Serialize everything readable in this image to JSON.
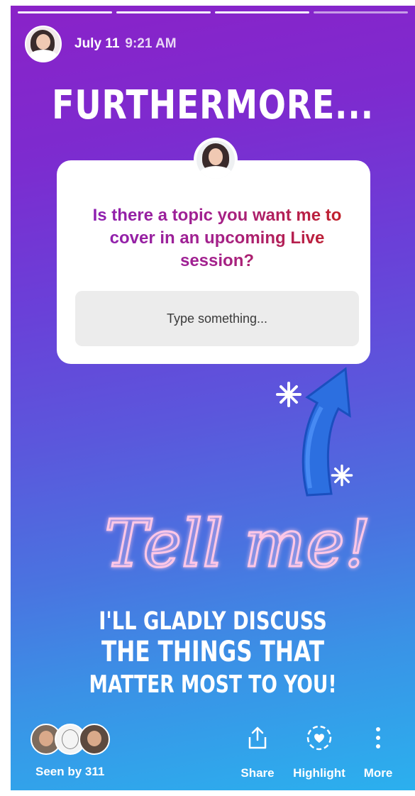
{
  "progress": {
    "segments": 4,
    "active_index": 3
  },
  "header": {
    "date": "July 11",
    "time": "9:21 AM"
  },
  "headline": "FURTHERMORE...",
  "question_sticker": {
    "question": "Is there a topic you want me to cover in an upcoming Live session?",
    "placeholder": "Type something..."
  },
  "tell_me": "Tell me!",
  "caption_lines": [
    "I'LL GLADLY DISCUSS",
    "THE THINGS THAT",
    "MATTER MOST TO YOU!"
  ],
  "footer": {
    "seen_by": "Seen by 311",
    "actions": [
      {
        "label": "Share",
        "icon": "share-icon"
      },
      {
        "label": "Highlight",
        "icon": "highlight-heart-icon"
      },
      {
        "label": "More",
        "icon": "more-dots-icon"
      }
    ]
  },
  "colors": {
    "gradient_top": "#8a22c8",
    "gradient_bottom": "#2bb0ee",
    "question_start": "#8b1fb6",
    "question_end": "#c4201f",
    "neon_pink": "#ffc7e6",
    "arrow_blue": "#2c6fe0"
  }
}
